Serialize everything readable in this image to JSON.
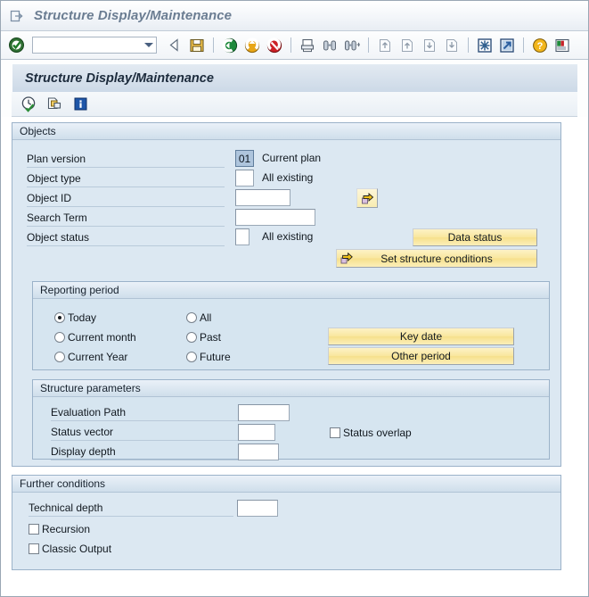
{
  "window": {
    "title": "Structure Display/Maintenance",
    "title_icon": "session-page-arrow-icon"
  },
  "toolbar": {
    "command_field_value": "",
    "command_field_placeholder": "",
    "icons": [
      {
        "name": "enter-check-icon",
        "glyph": "✔"
      },
      {
        "name": "back-arrow-icon",
        "glyph": "◁"
      },
      {
        "name": "save-disk-icon",
        "glyph": "▣"
      },
      {
        "name": "back-green-icon",
        "glyph": "←"
      },
      {
        "name": "exit-yellow-icon",
        "glyph": "↑"
      },
      {
        "name": "cancel-red-icon",
        "glyph": "✕"
      },
      {
        "name": "print-icon",
        "glyph": "⎙"
      },
      {
        "name": "find-icon",
        "glyph": "⌕"
      },
      {
        "name": "find-next-icon",
        "glyph": "⌕"
      },
      {
        "name": "first-page-icon",
        "glyph": "⇑"
      },
      {
        "name": "previous-page-icon",
        "glyph": "↑"
      },
      {
        "name": "next-page-icon",
        "glyph": "↓"
      },
      {
        "name": "last-page-icon",
        "glyph": "⇓"
      },
      {
        "name": "new-session-icon",
        "glyph": "✲"
      },
      {
        "name": "create-shortcut-icon",
        "glyph": "↗"
      },
      {
        "name": "help-question-icon",
        "glyph": "?"
      },
      {
        "name": "customize-layout-icon",
        "glyph": "▤"
      }
    ]
  },
  "screen": {
    "title": "Structure Display/Maintenance",
    "app_toolbar_icons": [
      {
        "name": "execute-clock-icon",
        "glyph": "◷"
      },
      {
        "name": "multiple-selection-icon",
        "glyph": "❐"
      },
      {
        "name": "information-icon",
        "glyph": "i"
      }
    ]
  },
  "objects": {
    "group_title": "Objects",
    "plan_version": {
      "label": "Plan version",
      "value": "01",
      "description": "Current plan"
    },
    "object_type": {
      "label": "Object type",
      "value": "",
      "description": "All existing"
    },
    "object_id": {
      "label": "Object ID",
      "value": ""
    },
    "search_term": {
      "label": "Search Term",
      "value": ""
    },
    "object_status": {
      "label": "Object status",
      "value": "",
      "description": "All existing"
    },
    "multiple_selection_button": {
      "name": "multiple-selection-arrow-button",
      "icon": "yellow-arrow-icon"
    },
    "data_status_button": "Data status",
    "set_structure_conditions_button": "Set structure conditions"
  },
  "reporting_period": {
    "group_title": "Reporting period",
    "options": [
      {
        "label": "Today",
        "selected": true
      },
      {
        "label": "Current month",
        "selected": false
      },
      {
        "label": "Current Year",
        "selected": false
      },
      {
        "label": "All",
        "selected": false
      },
      {
        "label": "Past",
        "selected": false
      },
      {
        "label": "Future",
        "selected": false
      }
    ],
    "key_date_button": "Key date",
    "other_period_button": "Other period"
  },
  "structure_parameters": {
    "group_title": "Structure parameters",
    "evaluation_path": {
      "label": "Evaluation Path",
      "value": ""
    },
    "status_vector": {
      "label": "Status vector",
      "value": ""
    },
    "display_depth": {
      "label": "Display depth",
      "value": ""
    },
    "status_overlap": {
      "label": "Status overlap",
      "checked": false
    }
  },
  "further_conditions": {
    "group_title": "Further conditions",
    "technical_depth": {
      "label": "Technical depth",
      "value": ""
    },
    "recursion": {
      "label": "Recursion",
      "checked": false
    },
    "classic_output": {
      "label": "Classic Output",
      "checked": false
    }
  },
  "colors": {
    "accent_button": "#f9e79f",
    "group_bg": "#dce8f2",
    "group_header": "#cfdeeb",
    "focused_field": "#aec5dd",
    "title_text": "#6b7d92"
  }
}
